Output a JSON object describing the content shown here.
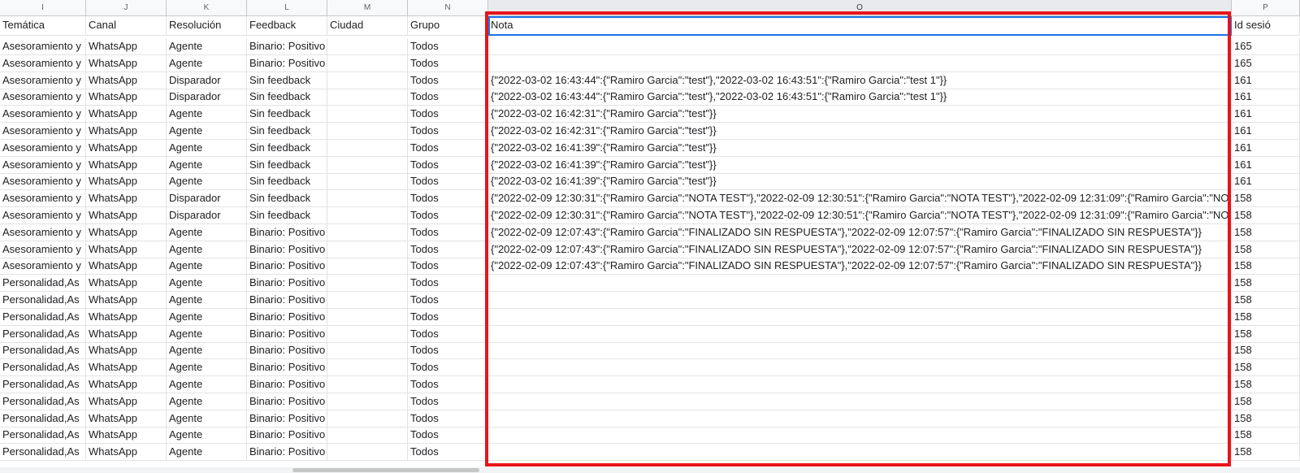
{
  "columns": [
    {
      "letter": "I",
      "header": "Temática"
    },
    {
      "letter": "J",
      "header": "Canal"
    },
    {
      "letter": "K",
      "header": "Resolución"
    },
    {
      "letter": "L",
      "header": "Feedback"
    },
    {
      "letter": "M",
      "header": "Ciudad"
    },
    {
      "letter": "N",
      "header": "Grupo"
    },
    {
      "letter": "O",
      "header": "Nota"
    },
    {
      "letter": "P",
      "header": "Id sesió"
    }
  ],
  "rows": [
    {
      "tematica": "Asesoramiento y",
      "canal": "WhatsApp",
      "resolucion": "Agente",
      "feedback": "Binario: Positivo",
      "ciudad": "",
      "grupo": "Todos",
      "nota": "",
      "id": "165"
    },
    {
      "tematica": "Asesoramiento y",
      "canal": "WhatsApp",
      "resolucion": "Agente",
      "feedback": "Binario: Positivo",
      "ciudad": "",
      "grupo": "Todos",
      "nota": "",
      "id": "165"
    },
    {
      "tematica": "Asesoramiento y",
      "canal": "WhatsApp",
      "resolucion": "Disparador",
      "feedback": "Sin feedback",
      "ciudad": "",
      "grupo": "Todos",
      "nota": "{\"2022-03-02 16:43:44\":{\"Ramiro Garcia\":\"test\"},\"2022-03-02 16:43:51\":{\"Ramiro Garcia\":\"test 1\"}}",
      "id": "161"
    },
    {
      "tematica": "Asesoramiento y",
      "canal": "WhatsApp",
      "resolucion": "Disparador",
      "feedback": "Sin feedback",
      "ciudad": "",
      "grupo": "Todos",
      "nota": "{\"2022-03-02 16:43:44\":{\"Ramiro Garcia\":\"test\"},\"2022-03-02 16:43:51\":{\"Ramiro Garcia\":\"test 1\"}}",
      "id": "161"
    },
    {
      "tematica": "Asesoramiento y",
      "canal": "WhatsApp",
      "resolucion": "Agente",
      "feedback": "Sin feedback",
      "ciudad": "",
      "grupo": "Todos",
      "nota": "{\"2022-03-02 16:42:31\":{\"Ramiro Garcia\":\"test\"}}",
      "id": "161"
    },
    {
      "tematica": "Asesoramiento y",
      "canal": "WhatsApp",
      "resolucion": "Agente",
      "feedback": "Sin feedback",
      "ciudad": "",
      "grupo": "Todos",
      "nota": "{\"2022-03-02 16:42:31\":{\"Ramiro Garcia\":\"test\"}}",
      "id": "161"
    },
    {
      "tematica": "Asesoramiento y",
      "canal": "WhatsApp",
      "resolucion": "Agente",
      "feedback": "Sin feedback",
      "ciudad": "",
      "grupo": "Todos",
      "nota": "{\"2022-03-02 16:41:39\":{\"Ramiro Garcia\":\"test\"}}",
      "id": "161"
    },
    {
      "tematica": "Asesoramiento y",
      "canal": "WhatsApp",
      "resolucion": "Agente",
      "feedback": "Sin feedback",
      "ciudad": "",
      "grupo": "Todos",
      "nota": "{\"2022-03-02 16:41:39\":{\"Ramiro Garcia\":\"test\"}}",
      "id": "161"
    },
    {
      "tematica": "Asesoramiento y",
      "canal": "WhatsApp",
      "resolucion": "Agente",
      "feedback": "Sin feedback",
      "ciudad": "",
      "grupo": "Todos",
      "nota": "{\"2022-03-02 16:41:39\":{\"Ramiro Garcia\":\"test\"}}",
      "id": "161"
    },
    {
      "tematica": "Asesoramiento y",
      "canal": "WhatsApp",
      "resolucion": "Disparador",
      "feedback": "Sin feedback",
      "ciudad": "",
      "grupo": "Todos",
      "nota": "{\"2022-02-09 12:30:31\":{\"Ramiro Garcia\":\"NOTA TEST\"},\"2022-02-09 12:30:51\":{\"Ramiro Garcia\":\"NOTA TEST\"},\"2022-02-09 12:31:09\":{\"Ramiro Garcia\":\"NO",
      "id": "158"
    },
    {
      "tematica": "Asesoramiento y",
      "canal": "WhatsApp",
      "resolucion": "Disparador",
      "feedback": "Sin feedback",
      "ciudad": "",
      "grupo": "Todos",
      "nota": "{\"2022-02-09 12:30:31\":{\"Ramiro Garcia\":\"NOTA TEST\"},\"2022-02-09 12:30:51\":{\"Ramiro Garcia\":\"NOTA TEST\"},\"2022-02-09 12:31:09\":{\"Ramiro Garcia\":\"NO",
      "id": "158"
    },
    {
      "tematica": "Asesoramiento y",
      "canal": "WhatsApp",
      "resolucion": "Agente",
      "feedback": "Binario: Positivo",
      "ciudad": "",
      "grupo": "Todos",
      "nota": "{\"2022-02-09 12:07:43\":{\"Ramiro Garcia\":\"FINALIZADO SIN RESPUESTA\"},\"2022-02-09 12:07:57\":{\"Ramiro Garcia\":\"FINALIZADO SIN RESPUESTA\"}}",
      "id": "158"
    },
    {
      "tematica": "Asesoramiento y",
      "canal": "WhatsApp",
      "resolucion": "Agente",
      "feedback": "Binario: Positivo",
      "ciudad": "",
      "grupo": "Todos",
      "nota": "{\"2022-02-09 12:07:43\":{\"Ramiro Garcia\":\"FINALIZADO SIN RESPUESTA\"},\"2022-02-09 12:07:57\":{\"Ramiro Garcia\":\"FINALIZADO SIN RESPUESTA\"}}",
      "id": "158"
    },
    {
      "tematica": "Asesoramiento y",
      "canal": "WhatsApp",
      "resolucion": "Agente",
      "feedback": "Binario: Positivo",
      "ciudad": "",
      "grupo": "Todos",
      "nota": "{\"2022-02-09 12:07:43\":{\"Ramiro Garcia\":\"FINALIZADO SIN RESPUESTA\"},\"2022-02-09 12:07:57\":{\"Ramiro Garcia\":\"FINALIZADO SIN RESPUESTA\"}}",
      "id": "158"
    },
    {
      "tematica": "Personalidad,As",
      "canal": "WhatsApp",
      "resolucion": "Agente",
      "feedback": "Binario: Positivo",
      "ciudad": "",
      "grupo": "Todos",
      "nota": "",
      "id": "158"
    },
    {
      "tematica": "Personalidad,As",
      "canal": "WhatsApp",
      "resolucion": "Agente",
      "feedback": "Binario: Positivo",
      "ciudad": "",
      "grupo": "Todos",
      "nota": "",
      "id": "158"
    },
    {
      "tematica": "Personalidad,As",
      "canal": "WhatsApp",
      "resolucion": "Agente",
      "feedback": "Binario: Positivo",
      "ciudad": "",
      "grupo": "Todos",
      "nota": "",
      "id": "158"
    },
    {
      "tematica": "Personalidad,As",
      "canal": "WhatsApp",
      "resolucion": "Agente",
      "feedback": "Binario: Positivo",
      "ciudad": "",
      "grupo": "Todos",
      "nota": "",
      "id": "158"
    },
    {
      "tematica": "Personalidad,As",
      "canal": "WhatsApp",
      "resolucion": "Agente",
      "feedback": "Binario: Positivo",
      "ciudad": "",
      "grupo": "Todos",
      "nota": "",
      "id": "158"
    },
    {
      "tematica": "Personalidad,As",
      "canal": "WhatsApp",
      "resolucion": "Agente",
      "feedback": "Binario: Positivo",
      "ciudad": "",
      "grupo": "Todos",
      "nota": "",
      "id": "158"
    },
    {
      "tematica": "Personalidad,As",
      "canal": "WhatsApp",
      "resolucion": "Agente",
      "feedback": "Binario: Positivo",
      "ciudad": "",
      "grupo": "Todos",
      "nota": "",
      "id": "158"
    },
    {
      "tematica": "Personalidad,As",
      "canal": "WhatsApp",
      "resolucion": "Agente",
      "feedback": "Binario: Positivo",
      "ciudad": "",
      "grupo": "Todos",
      "nota": "",
      "id": "158"
    },
    {
      "tematica": "Personalidad,As",
      "canal": "WhatsApp",
      "resolucion": "Agente",
      "feedback": "Binario: Positivo",
      "ciudad": "",
      "grupo": "Todos",
      "nota": "",
      "id": "158"
    },
    {
      "tematica": "Personalidad,As",
      "canal": "WhatsApp",
      "resolucion": "Agente",
      "feedback": "Binario: Positivo",
      "ciudad": "",
      "grupo": "Todos",
      "nota": "",
      "id": "158"
    },
    {
      "tematica": "Personalidad,As",
      "canal": "WhatsApp",
      "resolucion": "Agente",
      "feedback": "Binario: Positivo",
      "ciudad": "",
      "grupo": "Todos",
      "nota": "",
      "id": "158"
    }
  ],
  "colors": {
    "highlight": "#e8141b",
    "selection": "#1a73e8",
    "header_bg": "#f8f9fa",
    "grid": "#e2e3e3"
  }
}
